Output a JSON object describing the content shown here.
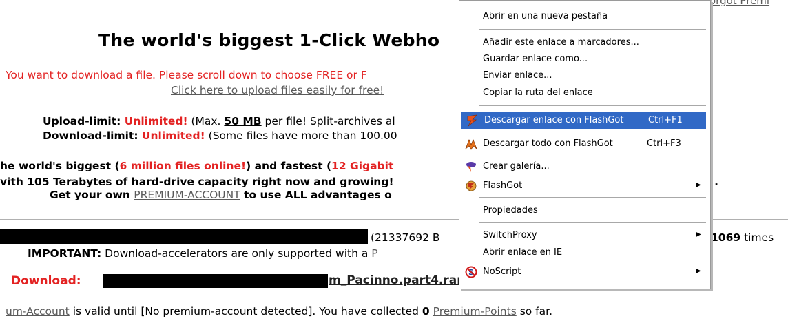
{
  "page": {
    "top_right_fragment": "orgot Premi",
    "title": "The world's biggest 1-Click Webho",
    "notice": "You want to download a file. Please scroll down to choose FREE or F",
    "upload_link": "Click here to upload files easily for free!",
    "upload_limit": {
      "label": "Upload-limit: ",
      "value": "Unlimited!",
      "text1": " (Max. ",
      "size": "50 MB",
      "text2": " per file! Split-archives al"
    },
    "download_limit": {
      "label": "Download-limit: ",
      "value": "Unlimited!",
      "text": " (Some files have more than 100.00"
    },
    "biggest_line": {
      "text1": "he world's biggest (",
      "files": "6 million files online!",
      "text2": ") and fastest (",
      "gigabit": "12 Gigabit"
    },
    "capacity_line": "vith 105 Terabytes of hard-drive capacity right now and growing!",
    "capacity_suffix": "!.",
    "premium_line": {
      "text1": "Get your own ",
      "link": "PREMIUM-ACCOUNT",
      "text2": " to use ALL advantages o"
    },
    "file_size": "(21337692 B",
    "download_count": {
      "number": "1069",
      "label": " times"
    },
    "important_line": {
      "label": "IMPORTANT:",
      "text": " Download-accelerators are only supported with a ",
      "link_fragment": "P"
    },
    "download_label": "Download:",
    "download_filename_fragment": "m_Pacinno.part4.rar",
    "account_line": {
      "link1": "um-Account",
      "text1": " is valid until [No premium-account detected]. You have collected ",
      "points": "0",
      "text2": " ",
      "link2": "Premium-Points",
      "text3": " so far."
    }
  },
  "context_menu": {
    "items": [
      {
        "label": "Abrir en una nueva pestaña"
      },
      {
        "label": "Añadir este enlace a marcadores..."
      },
      {
        "label": "Guardar enlace como..."
      },
      {
        "label": "Enviar enlace..."
      },
      {
        "label": "Copiar la ruta del enlace"
      },
      {
        "label": "Descargar enlace con FlashGot",
        "shortcut": "Ctrl+F1",
        "icon": "flashgot-bolt-icon",
        "highlighted": true
      },
      {
        "label": "Descargar todo con FlashGot",
        "shortcut": "Ctrl+F3",
        "icon": "flashgot-all-icon"
      },
      {
        "label": "Crear galería...",
        "icon": "gallery-icon"
      },
      {
        "label": "FlashGot",
        "icon": "flashgot-submenu-icon",
        "submenu": true
      },
      {
        "label": "Propiedades"
      },
      {
        "label": "SwitchProxy",
        "submenu": true
      },
      {
        "label": "Abrir enlace en IE"
      },
      {
        "label": "NoScript",
        "icon": "noscript-icon",
        "submenu": true
      }
    ]
  },
  "colors": {
    "accent_red": "#e32222",
    "highlight_blue": "#3169c6",
    "link_gray": "#5a5a5a"
  }
}
